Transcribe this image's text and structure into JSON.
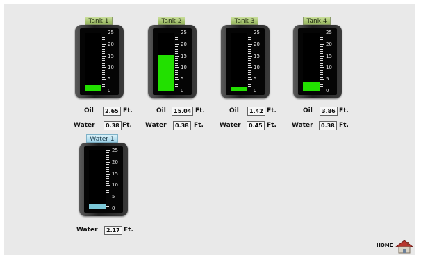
{
  "tanks": [
    {
      "label": "Tank 1",
      "type": "oil",
      "level_ft": 2.65,
      "oil_value": "2.65",
      "water_value": "0.38"
    },
    {
      "label": "Tank 2",
      "type": "oil",
      "level_ft": 15.04,
      "oil_value": "15.04",
      "water_value": "0.38"
    },
    {
      "label": "Tank 3",
      "type": "oil",
      "level_ft": 1.42,
      "oil_value": "1.42",
      "water_value": "0.45"
    },
    {
      "label": "Tank 4",
      "type": "oil",
      "level_ft": 3.86,
      "oil_value": "3.86",
      "water_value": "0.38"
    },
    {
      "label": "Water 1",
      "type": "water",
      "level_ft": 2.17,
      "water_value": "2.17"
    }
  ],
  "labels": {
    "oil": "Oil",
    "water": "Water",
    "unit": "Ft."
  },
  "scale": {
    "max": 25,
    "ticks": [
      "25",
      "20",
      "15",
      "10",
      "5",
      "0"
    ]
  },
  "home": {
    "label": "HOME"
  },
  "colors": {
    "oil_fill": "#22e000",
    "water_fill": "#7cc8d8",
    "tank_label_bg": "#a8c46a",
    "water_label_bg": "#b9e0ee"
  }
}
